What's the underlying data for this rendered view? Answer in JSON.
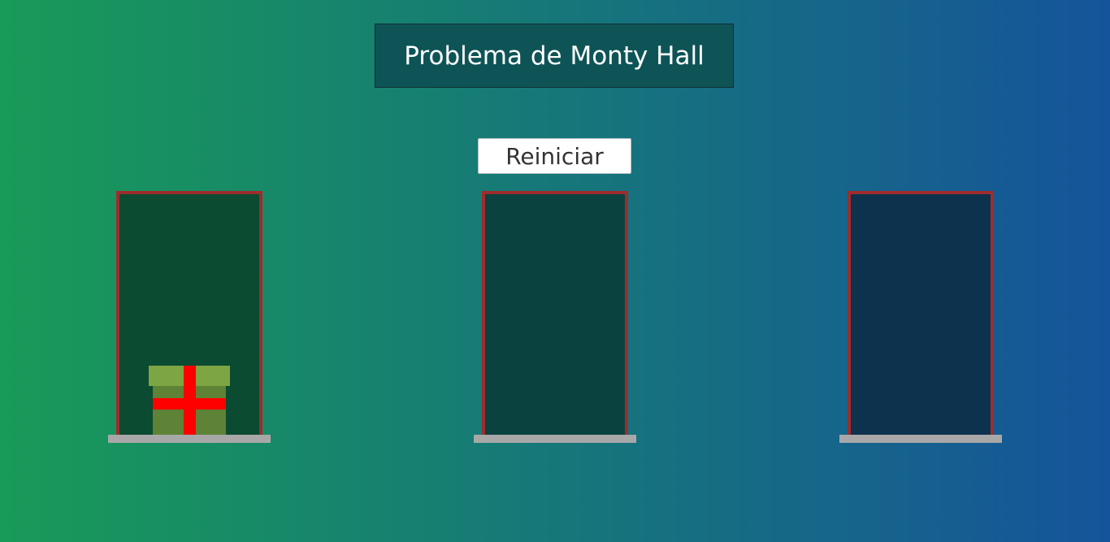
{
  "title": "Problema de Monty Hall",
  "reset_button": {
    "label": "Reiniciar"
  },
  "colors": {
    "background_left": "#189a58",
    "background_right": "#15549a",
    "title_box_bg": "#0e5457",
    "door_frame": "#9e2c2c",
    "door_1_fill": "#0b4b31",
    "door_2_fill": "#0a4240",
    "door_3_fill": "#0c324d",
    "sill": "#a8a8a8",
    "gift_lid": "#7da543",
    "gift_box": "#5e8236",
    "gift_ribbon": "#ff0000"
  },
  "doors": [
    {
      "state": "open",
      "contents": "gift-icon"
    },
    {
      "state": "open",
      "contents": ""
    },
    {
      "state": "open",
      "contents": ""
    }
  ]
}
